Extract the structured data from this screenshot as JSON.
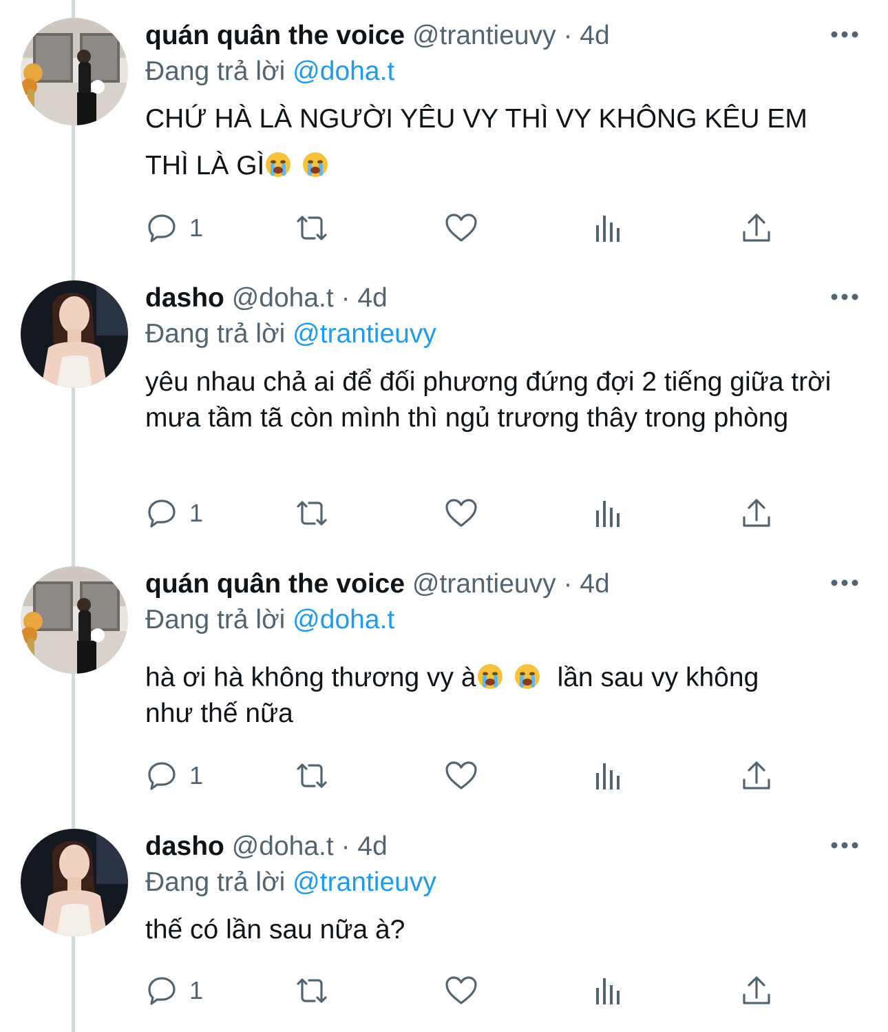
{
  "tweets": [
    {
      "name": "quán quân the voice",
      "handle": "@trantieuvy",
      "time": "4d",
      "reply_prefix": "Đang trả lời",
      "reply_to": "@doha.t",
      "text_parts": [
        "CHỨ HÀ LÀ NGƯỜI YÊU VY THÌ VY KHÔNG KÊU EM",
        "THÌ LÀ GÌ"
      ],
      "emoji": [
        "loudly-crying-face",
        "loudly-crying-face"
      ],
      "reply_count": "1"
    },
    {
      "name": "dasho",
      "handle": "@doha.t",
      "time": "4d",
      "reply_prefix": "Đang trả lời",
      "reply_to": "@trantieuvy",
      "text": "yêu nhau chả ai để đối phương đứng đợi 2 tiếng giữa trời mưa tầm tã còn mình thì ngủ trương thây trong phòng",
      "reply_count": "1"
    },
    {
      "name": "quán quân the voice",
      "handle": "@trantieuvy",
      "time": "4d",
      "reply_prefix": "Đang trả lời",
      "reply_to": "@doha.t",
      "text_parts": [
        "hà ơi hà không thương vy à",
        "lần sau vy không",
        "như thế nữa"
      ],
      "emoji": [
        "loudly-crying-face",
        "loudly-crying-face"
      ],
      "reply_count": "1"
    },
    {
      "name": "dasho",
      "handle": "@doha.t",
      "time": "4d",
      "reply_prefix": "Đang trả lời",
      "reply_to": "@trantieuvy",
      "text": "thế có lần sau nữa à?",
      "reply_count": "1"
    }
  ],
  "icons": {
    "reply": "reply-icon",
    "retweet": "retweet-icon",
    "like": "heart-icon",
    "views": "views-icon",
    "share": "share-icon",
    "more": "more-icon"
  },
  "colors": {
    "text": "#0f1419",
    "secondary": "#536471",
    "mention": "#1d9bf0",
    "thread_line": "#cfd9de"
  }
}
